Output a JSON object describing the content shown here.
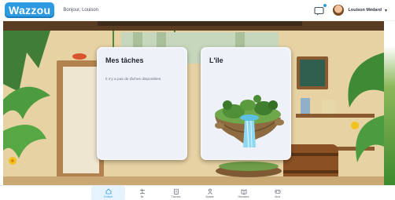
{
  "header": {
    "logo": "Wazzou",
    "greeting": "Bonjour, Louison",
    "user_name": "Louison Médard",
    "messages_icon": "message-icon",
    "caret_icon": "chevron-down-icon"
  },
  "cards": {
    "tasks": {
      "title": "Mes tâches",
      "empty_text": "Il n'y a pas de tâches disponibles."
    },
    "island": {
      "title": "L'île"
    }
  },
  "nav": {
    "items": [
      {
        "label": "Enfant",
        "icon": "home-icon",
        "active": true
      },
      {
        "label": "Île",
        "icon": "island-icon",
        "active": false
      },
      {
        "label": "Tâches",
        "icon": "clipboard-icon",
        "active": false
      },
      {
        "label": "Avatar",
        "icon": "person-icon",
        "active": false
      },
      {
        "label": "Histoires",
        "icon": "book-icon",
        "active": false
      },
      {
        "label": "Jeux",
        "icon": "gamepad-icon",
        "active": false
      }
    ]
  },
  "colors": {
    "brand": "#2d9be0",
    "card_bg": "#eef1f8",
    "scene_sand": "#e3cf9f"
  }
}
